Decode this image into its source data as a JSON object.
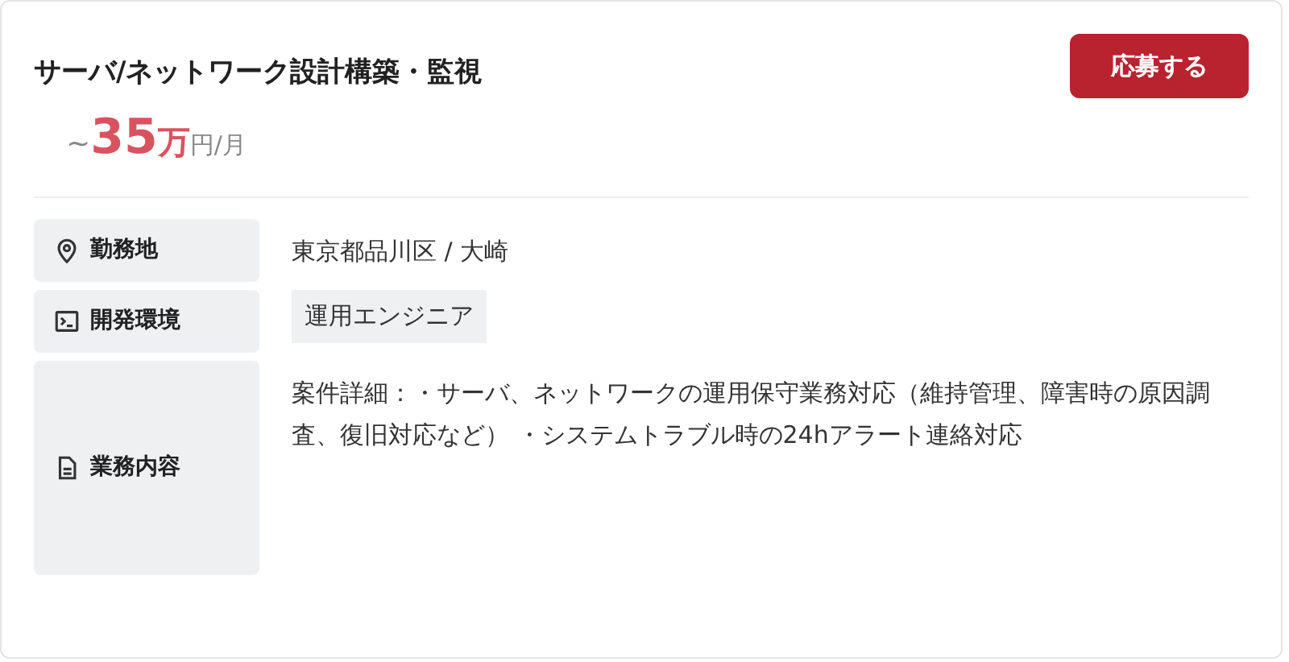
{
  "job": {
    "title": "サーバ/ネットワーク設計構築・監視",
    "apply_button": "応募する",
    "salary": {
      "prefix": "~",
      "amount": "35",
      "unit": "万",
      "suffix": "円/月"
    },
    "details": [
      {
        "kind": "location",
        "label": "勤務地",
        "value": "東京都品川区 / 大崎"
      },
      {
        "kind": "environment",
        "label": "開発環境",
        "tags": [
          "運用エンジニア"
        ]
      },
      {
        "kind": "description",
        "label": "業務内容",
        "value": "案件詳細：・サーバ、ネットワークの運用保守業務対応（維持管理、障害時の原因調査、復旧対応など） ・システムトラブル時の24hアラート連絡対応"
      }
    ]
  }
}
